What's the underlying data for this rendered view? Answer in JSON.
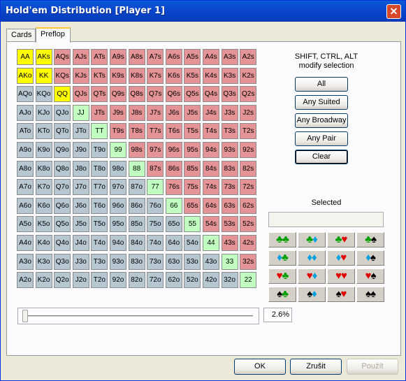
{
  "window": {
    "title": "Hold'em Distribution [Player 1]",
    "close_glyph": "✕"
  },
  "tabs": [
    {
      "label": "Cards",
      "active": false
    },
    {
      "label": "Preflop",
      "active": true
    }
  ],
  "colors": {
    "pair": "#ffff00",
    "suited_selected": "#ffff00",
    "pair_green": "#c0ffc0",
    "suited": "#e49396",
    "offsuit": "#b7c7d2",
    "selected": "#ffff00"
  },
  "range_grid": {
    "rows": [
      [
        "AA",
        "AKs",
        "AQs",
        "AJs",
        "ATs",
        "A9s",
        "A8s",
        "A7s",
        "A6s",
        "A5s",
        "A4s",
        "A3s",
        "A2s"
      ],
      [
        "AKo",
        "KK",
        "KQs",
        "KJs",
        "KTs",
        "K9s",
        "K8s",
        "K7s",
        "K6s",
        "K5s",
        "K4s",
        "K3s",
        "K2s"
      ],
      [
        "AQo",
        "KQo",
        "QQ",
        "QJs",
        "QTs",
        "Q9s",
        "Q8s",
        "Q7s",
        "Q6s",
        "Q5s",
        "Q4s",
        "Q3s",
        "Q2s"
      ],
      [
        "AJo",
        "KJo",
        "QJo",
        "JJ",
        "JTs",
        "J9s",
        "J8s",
        "J7s",
        "J6s",
        "J5s",
        "J4s",
        "J3s",
        "J2s"
      ],
      [
        "ATo",
        "KTo",
        "QTo",
        "JTo",
        "TT",
        "T9s",
        "T8s",
        "T7s",
        "T6s",
        "T5s",
        "T4s",
        "T3s",
        "T2s"
      ],
      [
        "A9o",
        "K9o",
        "Q9o",
        "J9o",
        "T9o",
        "99",
        "98s",
        "97s",
        "96s",
        "95s",
        "94s",
        "93s",
        "92s"
      ],
      [
        "A8o",
        "K8o",
        "Q8o",
        "J8o",
        "T8o",
        "98o",
        "88",
        "87s",
        "86s",
        "85s",
        "84s",
        "83s",
        "82s"
      ],
      [
        "A7o",
        "K7o",
        "Q7o",
        "J7o",
        "T7o",
        "97o",
        "87o",
        "77",
        "76s",
        "75s",
        "74s",
        "73s",
        "72s"
      ],
      [
        "A6o",
        "K6o",
        "Q6o",
        "J6o",
        "T6o",
        "96o",
        "86o",
        "76o",
        "66",
        "65s",
        "64s",
        "63s",
        "62s"
      ],
      [
        "A5o",
        "K5o",
        "Q5o",
        "J5o",
        "T5o",
        "95o",
        "85o",
        "75o",
        "65o",
        "55",
        "54s",
        "53s",
        "52s"
      ],
      [
        "A4o",
        "K4o",
        "Q4o",
        "J4o",
        "T4o",
        "94o",
        "84o",
        "74o",
        "64o",
        "54o",
        "44",
        "43s",
        "42s"
      ],
      [
        "A3o",
        "K3o",
        "Q3o",
        "J3o",
        "T3o",
        "93o",
        "83o",
        "73o",
        "63o",
        "53o",
        "43o",
        "33",
        "32s"
      ],
      [
        "A2o",
        "K2o",
        "Q2o",
        "J2o",
        "T2o",
        "92o",
        "82o",
        "72o",
        "62o",
        "52o",
        "42o",
        "32o",
        "22"
      ]
    ],
    "selected": [
      "AA",
      "AKs",
      "AKo",
      "KK",
      "QQ"
    ]
  },
  "hint": {
    "line1": "SHIFT, CTRL, ALT",
    "line2": "modify selection"
  },
  "buttons": {
    "all": "All",
    "any_suited": "Any Suited",
    "any_broadway": "Any Broadway",
    "any_pair": "Any Pair",
    "clear": "Clear"
  },
  "selected_label": "Selected",
  "selected_value": "",
  "suit_combos": [
    [
      "♣♣",
      "♣♦",
      "♣♥",
      "♣♠"
    ],
    [
      "♦♣",
      "♦♦",
      "♦♥",
      "♦♠"
    ],
    [
      "♥♣",
      "♥♦",
      "♥♥",
      "♥♠"
    ],
    [
      "♠♣",
      "♠♦",
      "♠♥",
      "♠♠"
    ]
  ],
  "suit_colors": {
    "♣": "#00a000",
    "♦": "#00a0e0",
    "♥": "#e00000",
    "♠": "#000000"
  },
  "slider": {
    "value_fraction": 0.026
  },
  "percent_text": "2.6%",
  "footer": {
    "ok": "OK",
    "cancel": "Zrušit",
    "apply": "Použít"
  }
}
